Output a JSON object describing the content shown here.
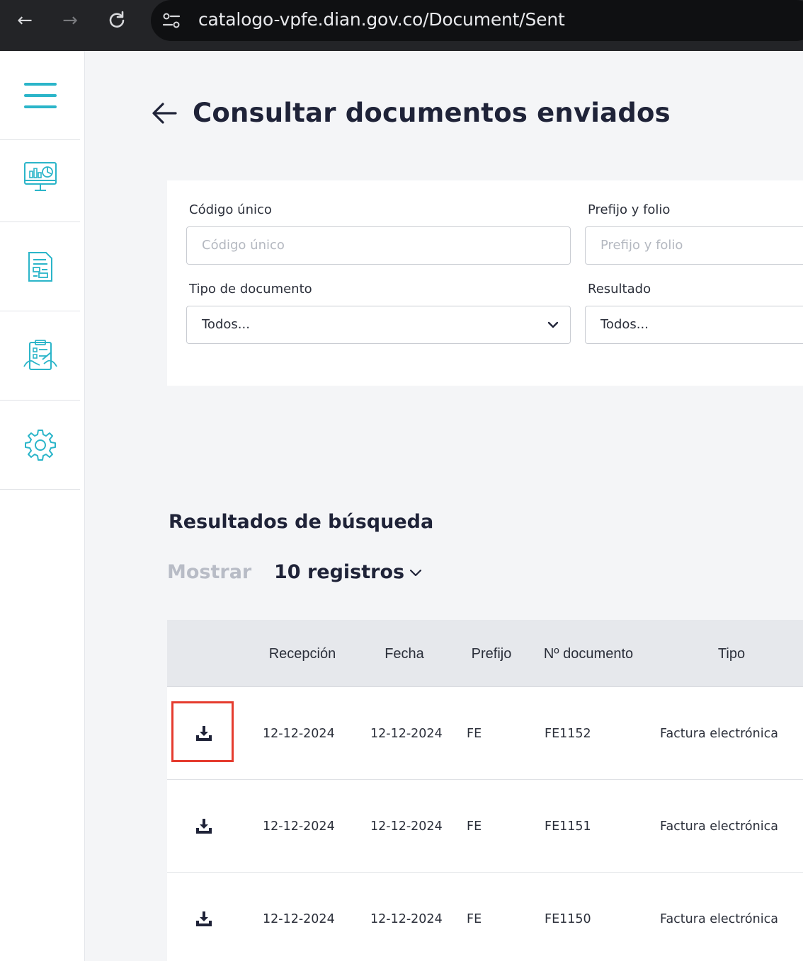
{
  "browser": {
    "url": "catalogo-vpfe.dian.gov.co/Document/Sent"
  },
  "sidebar": {
    "items": [
      {
        "name": "menu"
      },
      {
        "name": "dashboard"
      },
      {
        "name": "documents"
      },
      {
        "name": "reports"
      },
      {
        "name": "settings"
      }
    ],
    "accent_color": "#2bb5c9"
  },
  "page": {
    "title": "Consultar documentos enviados"
  },
  "filters": {
    "codigo_unico": {
      "label": "Código único",
      "placeholder": "Código único"
    },
    "prefijo_folio": {
      "label": "Prefijo y folio",
      "placeholder": "Prefijo y folio"
    },
    "tipo_documento": {
      "label": "Tipo de documento",
      "value": "Todos..."
    },
    "resultado": {
      "label": "Resultado",
      "value": "Todos..."
    }
  },
  "results": {
    "title": "Resultados de búsqueda",
    "show_label": "Mostrar",
    "page_size": "10 registros",
    "columns": [
      "",
      "Recepción",
      "Fecha",
      "Prefijo",
      "Nº documento",
      "Tipo"
    ],
    "rows": [
      {
        "recepcion": "12-12-2024",
        "fecha": "12-12-2024",
        "prefijo": "FE",
        "numero": "FE1152",
        "tipo": "Factura electrónica"
      },
      {
        "recepcion": "12-12-2024",
        "fecha": "12-12-2024",
        "prefijo": "FE",
        "numero": "FE1151",
        "tipo": "Factura electrónica"
      },
      {
        "recepcion": "12-12-2024",
        "fecha": "12-12-2024",
        "prefijo": "FE",
        "numero": "FE1150",
        "tipo": "Factura electrónica"
      }
    ]
  },
  "highlight_color": "#e53b2e"
}
